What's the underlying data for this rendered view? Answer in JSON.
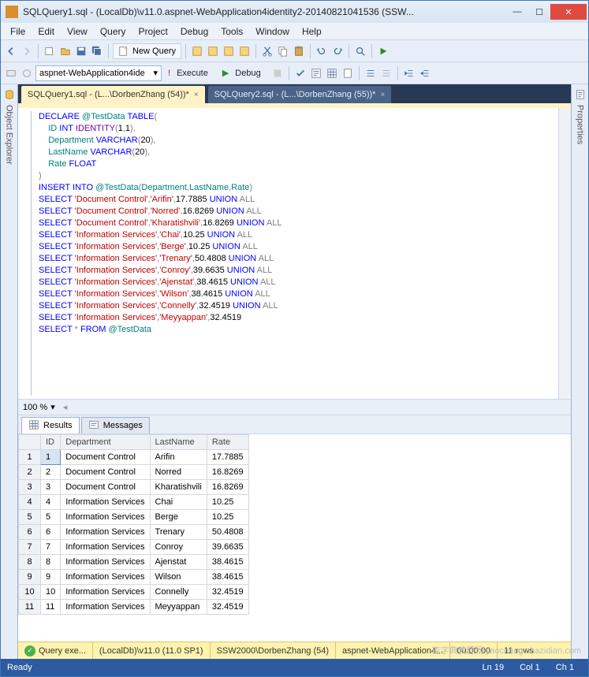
{
  "window": {
    "title": "SQLQuery1.sql - (LocalDb)\\v11.0.aspnet-WebApplication4identity2-20140821041536 (SSW...",
    "menu": [
      "File",
      "Edit",
      "View",
      "Query",
      "Project",
      "Debug",
      "Tools",
      "Window",
      "Help"
    ],
    "new_query": "New Query",
    "db_combo": "aspnet-WebApplication4ide",
    "execute": "Execute",
    "debug": "Debug",
    "tabs": [
      {
        "label": "SQLQuery1.sql - (L...\\DorbenZhang (54))*",
        "active": true
      },
      {
        "label": "SQLQuery2.sql - (L...\\DorbenZhang (55))*",
        "active": false
      }
    ]
  },
  "side": {
    "left": "Object Explorer",
    "right": "Properties"
  },
  "editor": {
    "lines": [
      [
        [
          "kw-blue",
          "DECLARE"
        ],
        [
          "txt",
          " "
        ],
        [
          "kw-teal",
          "@TestData"
        ],
        [
          "txt",
          " "
        ],
        [
          "kw-blue",
          "TABLE"
        ],
        [
          "kw-gray",
          "("
        ]
      ],
      [
        [
          "txt",
          "    "
        ],
        [
          "kw-teal",
          "ID"
        ],
        [
          "txt",
          " "
        ],
        [
          "kw-blue",
          "INT"
        ],
        [
          "txt",
          " "
        ],
        [
          "kw-purple",
          "IDENTITY"
        ],
        [
          "kw-gray",
          "("
        ],
        [
          "txt",
          "1"
        ],
        [
          "kw-gray",
          ","
        ],
        [
          "txt",
          "1"
        ],
        [
          "kw-gray",
          ")"
        ],
        [
          "kw-gray",
          ","
        ]
      ],
      [
        [
          "txt",
          "    "
        ],
        [
          "kw-teal",
          "Department"
        ],
        [
          "txt",
          " "
        ],
        [
          "kw-blue",
          "VARCHAR"
        ],
        [
          "kw-gray",
          "("
        ],
        [
          "txt",
          "20"
        ],
        [
          "kw-gray",
          ")"
        ],
        [
          "kw-gray",
          ","
        ]
      ],
      [
        [
          "txt",
          "    "
        ],
        [
          "kw-teal",
          "LastName"
        ],
        [
          "txt",
          " "
        ],
        [
          "kw-blue",
          "VARCHAR"
        ],
        [
          "kw-gray",
          "("
        ],
        [
          "txt",
          "20"
        ],
        [
          "kw-gray",
          ")"
        ],
        [
          "kw-gray",
          ","
        ]
      ],
      [
        [
          "txt",
          "    "
        ],
        [
          "kw-teal",
          "Rate"
        ],
        [
          "txt",
          " "
        ],
        [
          "kw-blue",
          "FLOAT"
        ]
      ],
      [
        [
          "kw-gray",
          ")"
        ]
      ],
      [
        [
          "kw-blue",
          "INSERT"
        ],
        [
          "txt",
          " "
        ],
        [
          "kw-blue",
          "INTO"
        ],
        [
          "txt",
          " "
        ],
        [
          "kw-teal",
          "@TestData"
        ],
        [
          "kw-gray",
          "("
        ],
        [
          "kw-teal",
          "Department"
        ],
        [
          "kw-gray",
          ","
        ],
        [
          "kw-teal",
          "LastName"
        ],
        [
          "kw-gray",
          ","
        ],
        [
          "kw-teal",
          "Rate"
        ],
        [
          "kw-gray",
          ")"
        ]
      ],
      [
        [
          "kw-blue",
          "SELECT"
        ],
        [
          "txt",
          " "
        ],
        [
          "kw-red",
          "'Document Control'"
        ],
        [
          "kw-gray",
          ","
        ],
        [
          "kw-red",
          "'Arifin'"
        ],
        [
          "kw-gray",
          ","
        ],
        [
          "txt",
          "17.7885 "
        ],
        [
          "kw-blue",
          "UNION"
        ],
        [
          "txt",
          " "
        ],
        [
          "kw-gray",
          "ALL"
        ]
      ],
      [
        [
          "kw-blue",
          "SELECT"
        ],
        [
          "txt",
          " "
        ],
        [
          "kw-red",
          "'Document Control'"
        ],
        [
          "kw-gray",
          ","
        ],
        [
          "kw-red",
          "'Norred'"
        ],
        [
          "kw-gray",
          ","
        ],
        [
          "txt",
          "16.8269 "
        ],
        [
          "kw-blue",
          "UNION"
        ],
        [
          "txt",
          " "
        ],
        [
          "kw-gray",
          "ALL"
        ]
      ],
      [
        [
          "kw-blue",
          "SELECT"
        ],
        [
          "txt",
          " "
        ],
        [
          "kw-red",
          "'Document Control'"
        ],
        [
          "kw-gray",
          ","
        ],
        [
          "kw-red",
          "'Kharatishvili'"
        ],
        [
          "kw-gray",
          ","
        ],
        [
          "txt",
          "16.8269 "
        ],
        [
          "kw-blue",
          "UNION"
        ],
        [
          "txt",
          " "
        ],
        [
          "kw-gray",
          "ALL"
        ]
      ],
      [
        [
          "kw-blue",
          "SELECT"
        ],
        [
          "txt",
          " "
        ],
        [
          "kw-red",
          "'Information Services'"
        ],
        [
          "kw-gray",
          ","
        ],
        [
          "kw-red",
          "'Chai'"
        ],
        [
          "kw-gray",
          ","
        ],
        [
          "txt",
          "10.25 "
        ],
        [
          "kw-blue",
          "UNION"
        ],
        [
          "txt",
          " "
        ],
        [
          "kw-gray",
          "ALL"
        ]
      ],
      [
        [
          "kw-blue",
          "SELECT"
        ],
        [
          "txt",
          " "
        ],
        [
          "kw-red",
          "'Information Services'"
        ],
        [
          "kw-gray",
          ","
        ],
        [
          "kw-red",
          "'Berge'"
        ],
        [
          "kw-gray",
          ","
        ],
        [
          "txt",
          "10.25 "
        ],
        [
          "kw-blue",
          "UNION"
        ],
        [
          "txt",
          " "
        ],
        [
          "kw-gray",
          "ALL"
        ]
      ],
      [
        [
          "kw-blue",
          "SELECT"
        ],
        [
          "txt",
          " "
        ],
        [
          "kw-red",
          "'Information Services'"
        ],
        [
          "kw-gray",
          ","
        ],
        [
          "kw-red",
          "'Trenary'"
        ],
        [
          "kw-gray",
          ","
        ],
        [
          "txt",
          "50.4808 "
        ],
        [
          "kw-blue",
          "UNION"
        ],
        [
          "txt",
          " "
        ],
        [
          "kw-gray",
          "ALL"
        ]
      ],
      [
        [
          "kw-blue",
          "SELECT"
        ],
        [
          "txt",
          " "
        ],
        [
          "kw-red",
          "'Information Services'"
        ],
        [
          "kw-gray",
          ","
        ],
        [
          "kw-red",
          "'Conroy'"
        ],
        [
          "kw-gray",
          ","
        ],
        [
          "txt",
          "39.6635 "
        ],
        [
          "kw-blue",
          "UNION"
        ],
        [
          "txt",
          " "
        ],
        [
          "kw-gray",
          "ALL"
        ]
      ],
      [
        [
          "kw-blue",
          "SELECT"
        ],
        [
          "txt",
          " "
        ],
        [
          "kw-red",
          "'Information Services'"
        ],
        [
          "kw-gray",
          ","
        ],
        [
          "kw-red",
          "'Ajenstat'"
        ],
        [
          "kw-gray",
          ","
        ],
        [
          "txt",
          "38.4615 "
        ],
        [
          "kw-blue",
          "UNION"
        ],
        [
          "txt",
          " "
        ],
        [
          "kw-gray",
          "ALL"
        ]
      ],
      [
        [
          "kw-blue",
          "SELECT"
        ],
        [
          "txt",
          " "
        ],
        [
          "kw-red",
          "'Information Services'"
        ],
        [
          "kw-gray",
          ","
        ],
        [
          "kw-red",
          "'Wilson'"
        ],
        [
          "kw-gray",
          ","
        ],
        [
          "txt",
          "38.4615 "
        ],
        [
          "kw-blue",
          "UNION"
        ],
        [
          "txt",
          " "
        ],
        [
          "kw-gray",
          "ALL"
        ]
      ],
      [
        [
          "kw-blue",
          "SELECT"
        ],
        [
          "txt",
          " "
        ],
        [
          "kw-red",
          "'Information Services'"
        ],
        [
          "kw-gray",
          ","
        ],
        [
          "kw-red",
          "'Connelly'"
        ],
        [
          "kw-gray",
          ","
        ],
        [
          "txt",
          "32.4519 "
        ],
        [
          "kw-blue",
          "UNION"
        ],
        [
          "txt",
          " "
        ],
        [
          "kw-gray",
          "ALL"
        ]
      ],
      [
        [
          "kw-blue",
          "SELECT"
        ],
        [
          "txt",
          " "
        ],
        [
          "kw-red",
          "'Information Services'"
        ],
        [
          "kw-gray",
          ","
        ],
        [
          "kw-red",
          "'Meyyappan'"
        ],
        [
          "kw-gray",
          ","
        ],
        [
          "txt",
          "32.4519"
        ]
      ],
      [
        [
          "txt",
          ""
        ]
      ],
      [
        [
          "kw-blue",
          "SELECT"
        ],
        [
          "txt",
          " "
        ],
        [
          "kw-gray",
          "*"
        ],
        [
          "txt",
          " "
        ],
        [
          "kw-blue",
          "FROM"
        ],
        [
          "txt",
          " "
        ],
        [
          "kw-teal",
          "@TestData"
        ]
      ]
    ]
  },
  "zoom": "100 %",
  "results": {
    "tabs": [
      "Results",
      "Messages"
    ],
    "columns": [
      "",
      "ID",
      "Department",
      "LastName",
      "Rate"
    ],
    "rows": [
      [
        "1",
        "1",
        "Document Control",
        "Arifin",
        "17.7885"
      ],
      [
        "2",
        "2",
        "Document Control",
        "Norred",
        "16.8269"
      ],
      [
        "3",
        "3",
        "Document Control",
        "Kharatishvili",
        "16.8269"
      ],
      [
        "4",
        "4",
        "Information Services",
        "Chai",
        "10.25"
      ],
      [
        "5",
        "5",
        "Information Services",
        "Berge",
        "10.25"
      ],
      [
        "6",
        "6",
        "Information Services",
        "Trenary",
        "50.4808"
      ],
      [
        "7",
        "7",
        "Information Services",
        "Conroy",
        "39.6635"
      ],
      [
        "8",
        "8",
        "Information Services",
        "Ajenstat",
        "38.4615"
      ],
      [
        "9",
        "9",
        "Information Services",
        "Wilson",
        "38.4615"
      ],
      [
        "10",
        "10",
        "Information Services",
        "Connelly",
        "32.4519"
      ],
      [
        "11",
        "11",
        "Information Services",
        "Meyyappan",
        "32.4519"
      ]
    ]
  },
  "status1": {
    "query": "Query exe...",
    "server": "(LocalDb)\\v11.0 (11.0 SP1)",
    "user": "SSW2000\\DorbenZhang (54)",
    "db": "aspnet-WebApplication4...",
    "time": "00:00:00",
    "rows": "11 rows"
  },
  "status2": {
    "ready": "Ready",
    "ln": "Ln 19",
    "col": "Col 1",
    "ch": "Ch 1"
  },
  "watermark": "查字典教程网  jiaocheng.chazidian.com"
}
